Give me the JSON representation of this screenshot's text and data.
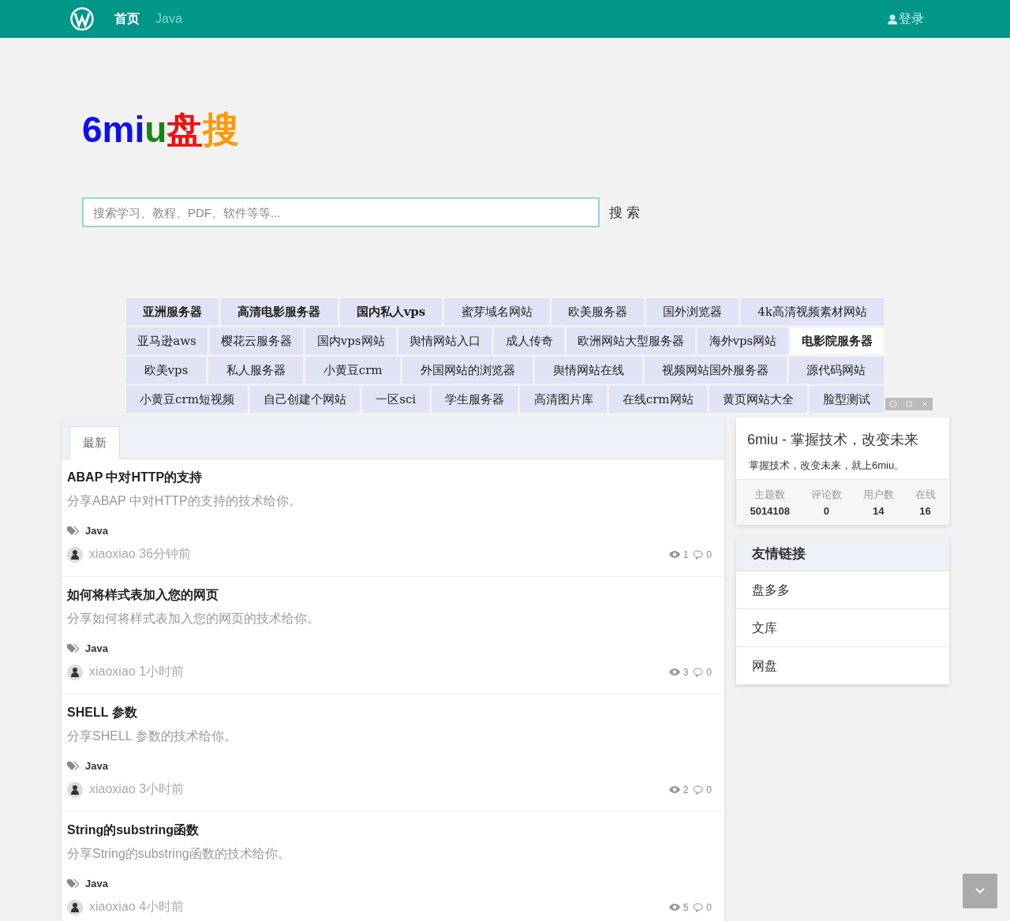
{
  "navbar": {
    "items": [
      {
        "label": "首页",
        "selected": true
      },
      {
        "label": "Java",
        "selected": false
      }
    ],
    "login": "登录"
  },
  "logo": [
    {
      "text": "6mi",
      "color": "#1010ee"
    },
    {
      "text": "u",
      "color": "#118811"
    },
    {
      "text": "盘",
      "color": "#ee1111"
    },
    {
      "text": "搜",
      "color": "#ff9900"
    }
  ],
  "search": {
    "placeholder": "搜索学习、教程、PDF、软件等等...",
    "button": "搜 索"
  },
  "tag_rows": [
    [
      {
        "label": "亚洲服务器",
        "bold": true,
        "highlighted": false
      },
      {
        "label": "高清电影服务器",
        "bold": true,
        "highlighted": false
      },
      {
        "label": "国内私人vps",
        "bold": true,
        "highlighted": false
      },
      {
        "label": "蜜芽域名网站",
        "bold": false,
        "highlighted": false
      },
      {
        "label": "欧美服务器",
        "bold": false,
        "highlighted": false
      },
      {
        "label": "国外浏览器",
        "bold": false,
        "highlighted": false
      },
      {
        "label": "4k高清视频素材网站",
        "bold": false,
        "highlighted": false
      }
    ],
    [
      {
        "label": "亚马逊aws",
        "bold": false,
        "highlighted": false
      },
      {
        "label": "樱花云服务器",
        "bold": false,
        "highlighted": false
      },
      {
        "label": "国内vps网站",
        "bold": false,
        "highlighted": false
      },
      {
        "label": "舆情网站入口",
        "bold": false,
        "highlighted": false
      },
      {
        "label": "成人传奇",
        "bold": false,
        "highlighted": false
      },
      {
        "label": "欧洲网站大型服务器",
        "bold": false,
        "highlighted": false
      },
      {
        "label": "海外vps网站",
        "bold": false,
        "highlighted": false
      },
      {
        "label": "电影院服务器",
        "bold": true,
        "highlighted": true
      }
    ],
    [
      {
        "label": "欧美vps",
        "bold": false,
        "highlighted": false
      },
      {
        "label": "私人服务器",
        "bold": false,
        "highlighted": false
      },
      {
        "label": "小黄豆crm",
        "bold": false,
        "highlighted": false
      },
      {
        "label": "外国网站的浏览器",
        "bold": false,
        "highlighted": false
      },
      {
        "label": "舆情网站在线",
        "bold": false,
        "highlighted": false
      },
      {
        "label": "视频网站国外服务器",
        "bold": false,
        "highlighted": false
      },
      {
        "label": "源代码网站",
        "bold": false,
        "highlighted": false
      }
    ],
    [
      {
        "label": "小黄豆crm短视频",
        "bold": false,
        "highlighted": false
      },
      {
        "label": "自己创建个网站",
        "bold": false,
        "highlighted": false
      },
      {
        "label": "一区sci",
        "bold": false,
        "highlighted": false
      },
      {
        "label": "学生服务器",
        "bold": false,
        "highlighted": false
      },
      {
        "label": "高清图片库",
        "bold": false,
        "highlighted": false
      },
      {
        "label": "在线crm网站",
        "bold": false,
        "highlighted": false
      },
      {
        "label": "黄页网站大全",
        "bold": false,
        "highlighted": false
      },
      {
        "label": "脸型测试",
        "bold": false,
        "highlighted": false
      }
    ]
  ],
  "tabs": [
    {
      "label": "最新",
      "selected": true
    }
  ],
  "posts": [
    {
      "title": "ABAP 中对HTTP的支持",
      "summary": "分享ABAP 中对HTTP的支持的技术给你。",
      "tag": "Java",
      "author": "xiaoxiao",
      "time": "36分钟前",
      "views": "1",
      "comments": "0"
    },
    {
      "title": "如何将样式表加入您的网页",
      "summary": "分享如何将样式表加入您的网页的技术给你。",
      "tag": "Java",
      "author": "xiaoxiao",
      "time": "1小时前",
      "views": "3",
      "comments": "0"
    },
    {
      "title": "SHELL 参数",
      "summary": "分享SHELL 参数的技术给你。",
      "tag": "Java",
      "author": "xiaoxiao",
      "time": "3小时前",
      "views": "2",
      "comments": "0"
    },
    {
      "title": "String的substring函数",
      "summary": "分享String的substring函数的技术给你。",
      "tag": "Java",
      "author": "xiaoxiao",
      "time": "4小时前",
      "views": "5",
      "comments": "0"
    }
  ],
  "site_card": {
    "title": "6miu - 掌握技术，改变未来",
    "subtitle": "掌握技术，改变未来，就上6miu。",
    "stats": [
      {
        "label": "主题数",
        "value": "5014108"
      },
      {
        "label": "评论数",
        "value": "0"
      },
      {
        "label": "用户数",
        "value": "14"
      },
      {
        "label": "在线",
        "value": "16"
      }
    ]
  },
  "friend_links": {
    "title": "友情链接",
    "items": [
      "盘多多",
      "文库",
      "网盘"
    ]
  }
}
